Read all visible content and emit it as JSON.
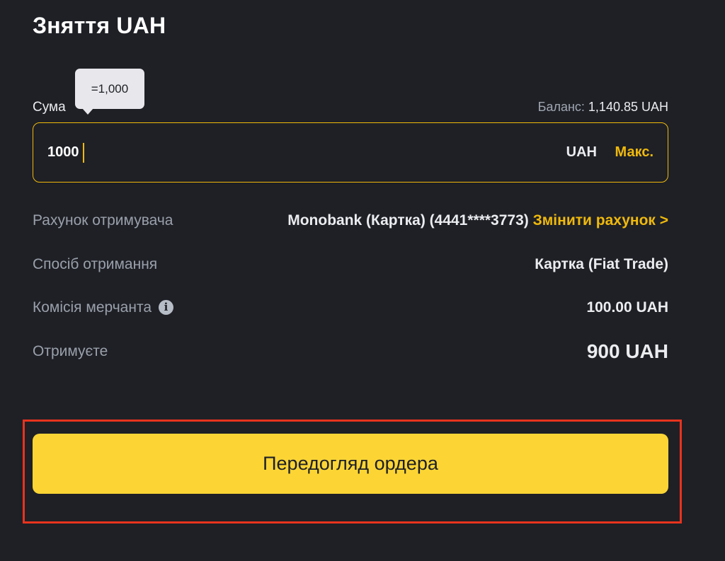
{
  "header": {
    "title": "Зняття UAH"
  },
  "amount": {
    "label": "Сума",
    "tooltip": "=1,000",
    "balance_label": "Баланс:",
    "balance_value": "1,140.85 UAH",
    "input_value": "1000",
    "currency": "UAH",
    "max_label": "Макс."
  },
  "details": {
    "recipient_label": "Рахунок отримувача",
    "recipient_value": "Monobank (Картка) (4441****3773)",
    "change_account_label": "Змінити рахунок >",
    "method_label": "Спосіб отримання",
    "method_value": "Картка (Fiat Trade)",
    "fee_label": "Комісія мерчанта",
    "fee_value": "100.00 UAH",
    "receive_label": "Отримуєте",
    "receive_value": "900 UAH"
  },
  "actions": {
    "preview_label": "Передогляд ордера"
  },
  "icons": {
    "info": "info-icon"
  },
  "colors": {
    "background": "#1e2026",
    "accent": "#f0b90b",
    "button": "#fcd535",
    "highlight": "#e8331e"
  }
}
